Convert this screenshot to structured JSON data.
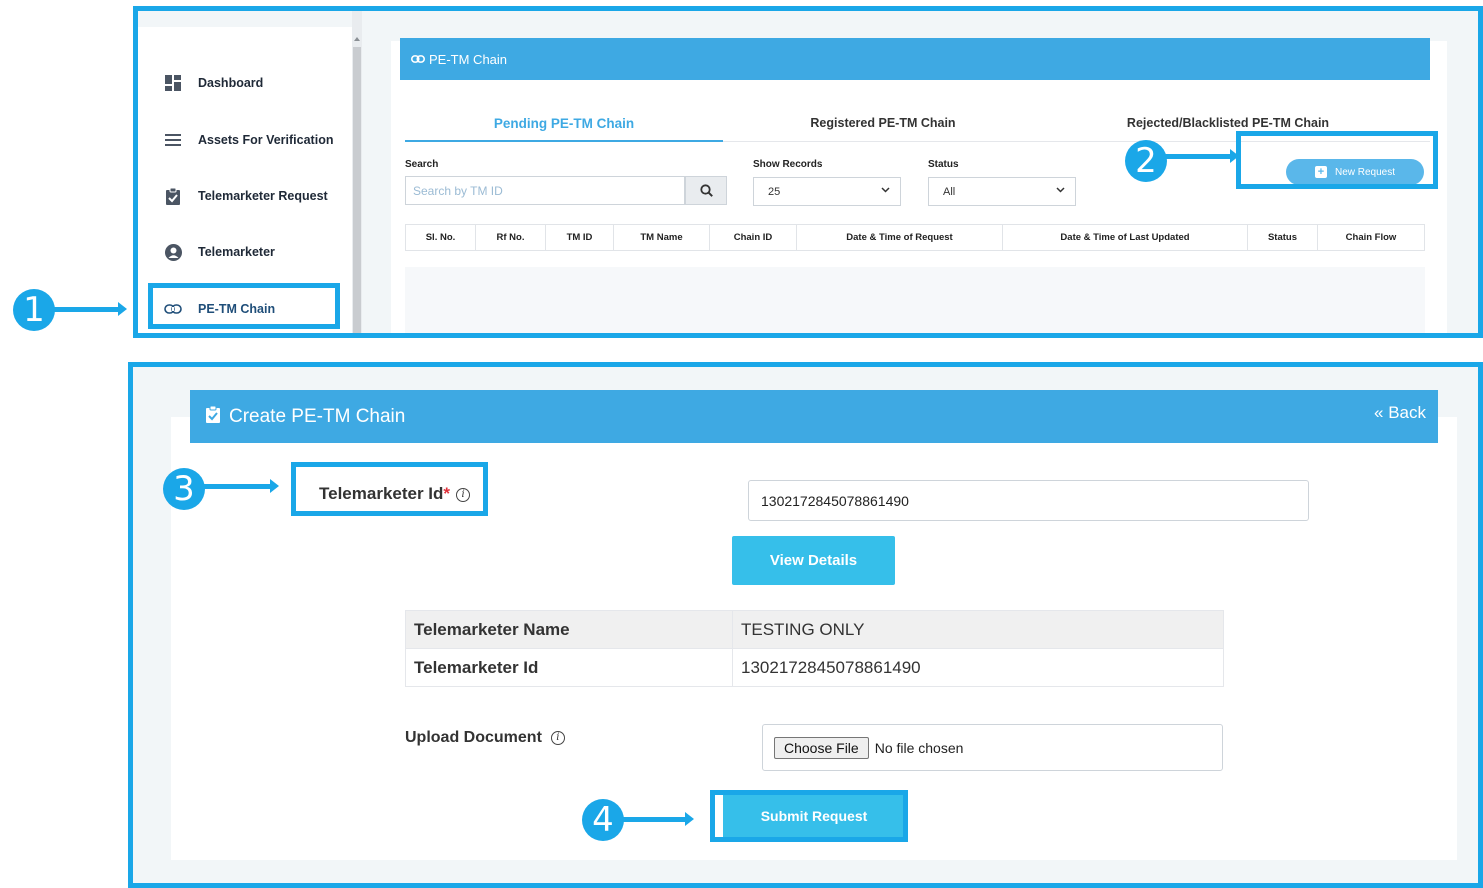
{
  "top_panel": {
    "sidebar": {
      "items": [
        {
          "label": "Dashboard",
          "icon": "dashboard-icon"
        },
        {
          "label": "Assets For Verification",
          "icon": "list-icon"
        },
        {
          "label": "Telemarketer Request",
          "icon": "clipboard-check-icon"
        },
        {
          "label": "Telemarketer",
          "icon": "user-circle-icon"
        },
        {
          "label": "PE-TM Chain",
          "icon": "link-icon"
        }
      ],
      "active": "PE-TM Chain"
    },
    "header_title": "PE-TM Chain",
    "tabs": [
      {
        "label": "Pending PE-TM Chain",
        "active": true
      },
      {
        "label": "Registered PE-TM Chain",
        "active": false
      },
      {
        "label": "Rejected/Blacklisted PE-TM Chain",
        "active": false
      }
    ],
    "filters": {
      "search_label": "Search",
      "search_placeholder": "Search by TM ID",
      "show_records_label": "Show Records",
      "show_records_value": "25",
      "status_label": "Status",
      "status_value": "All"
    },
    "new_request_label": "New Request",
    "table_headers": [
      "Sl. No.",
      "Rf No.",
      "TM ID",
      "TM Name",
      "Chain ID",
      "Date & Time of Request",
      "Date & Time of Last Updated",
      "Status",
      "Chain Flow"
    ]
  },
  "bottom_panel": {
    "title": "Create PE-TM Chain",
    "back_label": "« Back",
    "telemarketer_id_label": "Telemarketer Id",
    "required_mark": "*",
    "telemarketer_id_value": "1302172845078861490",
    "view_details_label": "View Details",
    "details": [
      {
        "key": "Telemarketer Name",
        "value": "TESTING ONLY"
      },
      {
        "key": "Telemarketer Id",
        "value": "1302172845078861490"
      }
    ],
    "upload_label": "Upload Document",
    "choose_file_label": "Choose File",
    "no_file_text": "No file chosen",
    "submit_label": "Submit Request"
  },
  "callouts": [
    "1",
    "2",
    "3",
    "4"
  ],
  "colors": {
    "accent": "#3ea9e3",
    "highlight": "#1aa7e8",
    "button": "#36bfea"
  }
}
